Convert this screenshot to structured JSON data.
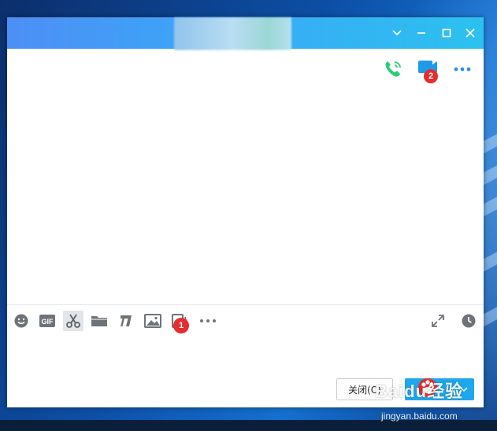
{
  "window": {
    "title": "",
    "controls": [
      "chevron-down-icon",
      "minimize-icon",
      "maximize-icon",
      "close-icon"
    ]
  },
  "header_actions": {
    "voice_call": {
      "icon": "phone-call-icon"
    },
    "video_call": {
      "icon": "video-call-icon",
      "annotation": "2"
    },
    "more": {
      "icon": "more-icon"
    }
  },
  "toolbar": {
    "tools": [
      "emoji-icon",
      "gif-icon",
      "scissors-icon",
      "folder-icon",
      "music-icon",
      "image-icon",
      "screen-share-icon",
      "more-icon"
    ],
    "annotation": "1",
    "right_tools": [
      "expand-icon",
      "clock-icon"
    ]
  },
  "buttons": {
    "close_label": "关闭(C)",
    "send_label": ""
  },
  "watermark": {
    "brand": "Baidu经验",
    "url": "jingyan.baidu.com"
  },
  "colors": {
    "titlebar_start": "#4d8ff5",
    "titlebar_end": "#2cc1ef",
    "send_button": "#1ea7ea",
    "badge": "#e52d2d",
    "phone_icon": "#2ecb7b",
    "video_icon": "#1e9be8",
    "more_icon": "#2f8ff0",
    "toolbar_icon": "#6e7379"
  }
}
